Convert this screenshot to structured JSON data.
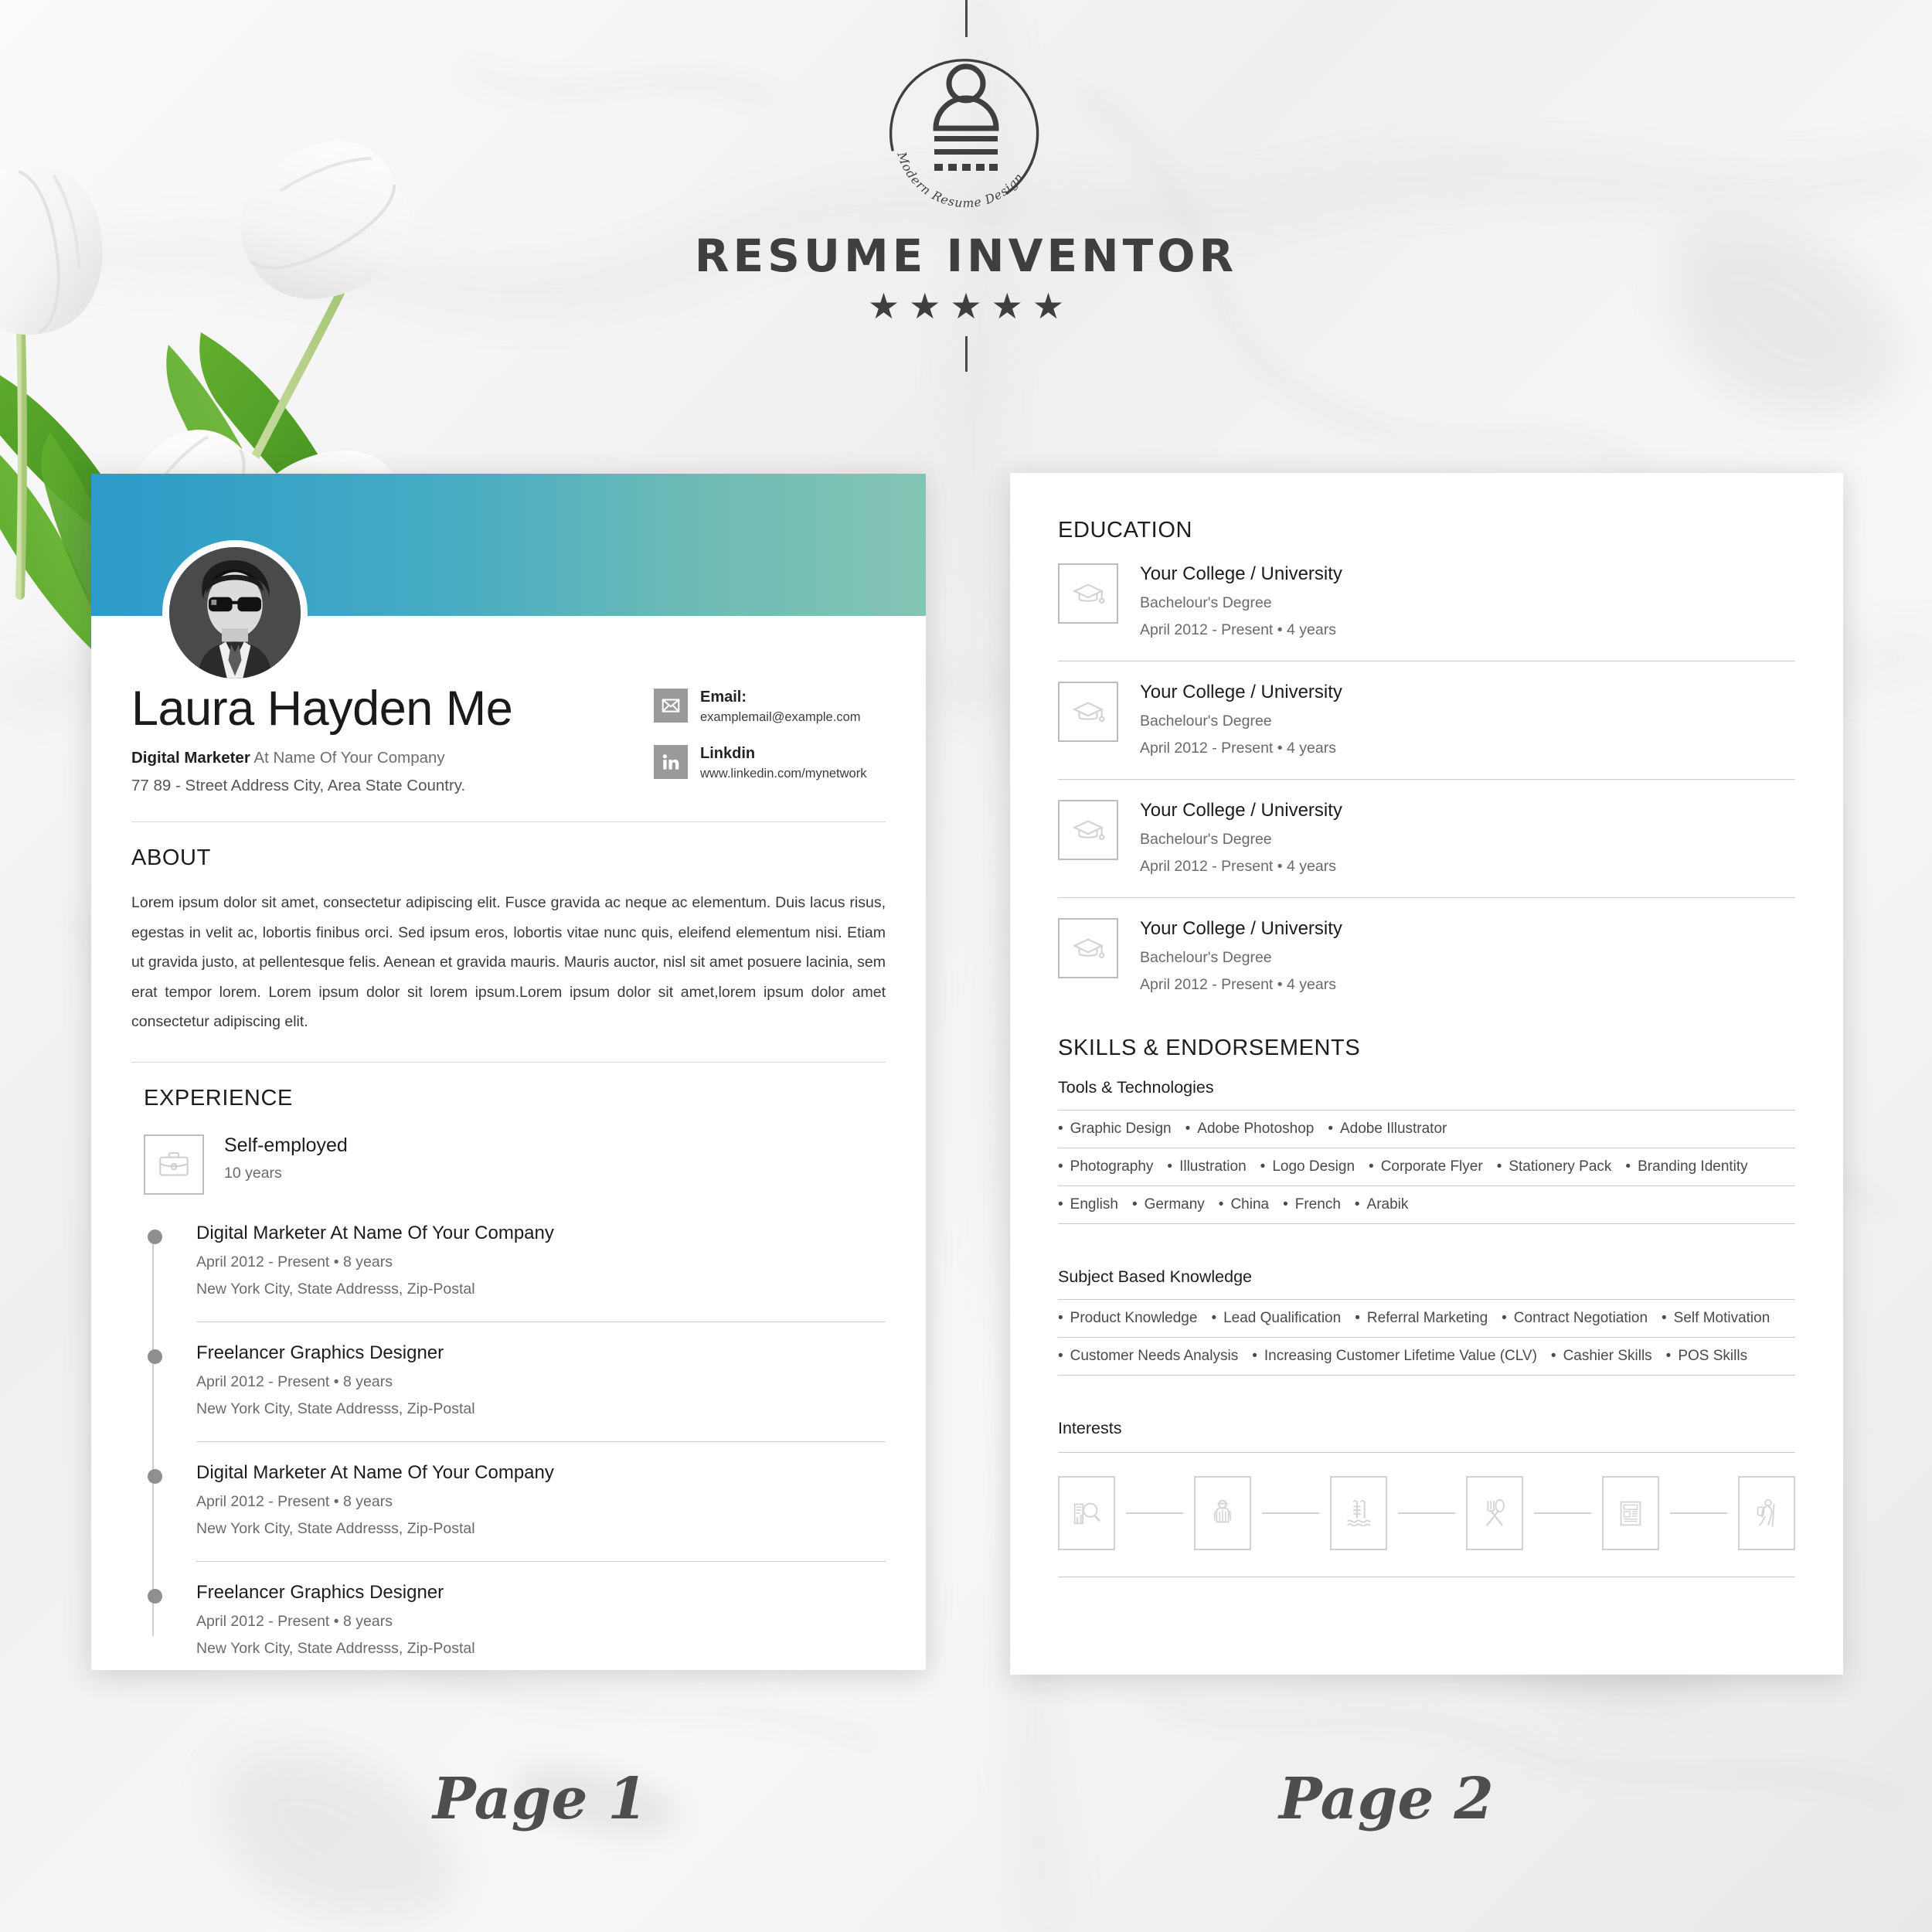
{
  "branding": {
    "title": "RESUME INVENTOR",
    "mark_tagline": "Modern Resume Design",
    "stars": "★ ★ ★ ★ ★",
    "star_count": 5
  },
  "page1": {
    "label": "Page 1",
    "avatar_alt": "profile-photo",
    "identity": {
      "full_name": "Laura Hayden Me",
      "role_bold": "Digital Marketer",
      "role_rest": "At Name Of Your Company",
      "address": "77 89 - Street Address City, Area State Country."
    },
    "contacts": [
      {
        "icon": "envelope-icon",
        "label": "Email:",
        "value": "examplemail@example.com"
      },
      {
        "icon": "linkedin-icon",
        "label": "Linkdin",
        "value": "www.linkedin.com/mynetwork"
      }
    ],
    "about": {
      "title": "ABOUT",
      "text": "Lorem ipsum dolor sit amet, consectetur adipiscing elit. Fusce gravida ac neque ac elementum. Duis lacus risus, egestas in velit ac, lobortis finibus orci. Sed ipsum eros, lobortis vitae nunc quis, eleifend elementum nisi. Etiam ut gravida justo, at pellentesque felis. Aenean et gravida mauris. Mauris auctor, nisl sit amet posuere lacinia, sem erat tempor lorem. Lorem ipsum dolor sit lorem ipsum.Lorem ipsum dolor sit amet,lorem ipsum dolor amet consectetur adipiscing elit."
    },
    "experience": {
      "title": "EXPERIENCE",
      "employer": {
        "icon": "briefcase-icon",
        "name": "Self-employed",
        "duration": "10 years"
      },
      "items": [
        {
          "title": "Digital Marketer At Name Of Your Company",
          "meta": "April 2012 - Present  •  8 years",
          "location": "New York City, State Addresss, Zip-Postal"
        },
        {
          "title": "Freelancer Graphics Designer",
          "meta": "April 2012 - Present  •  8 years",
          "location": "New York City, State Addresss, Zip-Postal"
        },
        {
          "title": "Digital Marketer At Name Of Your Company",
          "meta": "April 2012 - Present  •  8 years",
          "location": "New York City, State Addresss, Zip-Postal"
        },
        {
          "title": "Freelancer Graphics Designer",
          "meta": "April 2012 - Present  •  8 years",
          "location": "New York City, State Addresss, Zip-Postal"
        }
      ]
    }
  },
  "page2": {
    "label": "Page 2",
    "education": {
      "title": "EDUCATION",
      "items": [
        {
          "icon": "graduation-cap-icon",
          "school": "Your College / University",
          "degree": "Bachelour's Degree",
          "meta": "April 2012 - Present  •  4 years"
        },
        {
          "icon": "graduation-cap-icon",
          "school": "Your College / University",
          "degree": "Bachelour's Degree",
          "meta": "April 2012 - Present  •  4 years"
        },
        {
          "icon": "graduation-cap-icon",
          "school": "Your College / University",
          "degree": "Bachelour's Degree",
          "meta": "April 2012 - Present  •  4 years"
        },
        {
          "icon": "graduation-cap-icon",
          "school": "Your College / University",
          "degree": "Bachelour's Degree",
          "meta": "April 2012 - Present  •  4 years"
        }
      ]
    },
    "skills": {
      "title": "SKILLS & ENDORSEMENTS",
      "groups": [
        {
          "heading": "Tools & Technologies",
          "rows": [
            [
              "Graphic Design",
              "Adobe Photoshop",
              "Adobe Illustrator"
            ],
            [
              "Photography",
              "Illustration",
              "Logo Design",
              "Corporate Flyer",
              "Stationery Pack",
              "Branding Identity"
            ],
            [
              "English",
              "Germany",
              "China",
              "French",
              "Arabik"
            ]
          ]
        },
        {
          "heading": "Subject Based Knowledge",
          "rows": [
            [
              "Product Knowledge",
              "Lead Qualification",
              "Referral Marketing",
              "Contract Negotiation",
              "Self Motivation"
            ],
            [
              "Customer Needs Analysis",
              "Increasing Customer Lifetime Value (CLV)",
              "Cashier Skills",
              "POS Skills"
            ]
          ]
        }
      ]
    },
    "interests": {
      "title": "Interests",
      "icons": [
        "research-analytics-icon",
        "hiker-icon",
        "swimming-pool-icon",
        "dining-icon",
        "newspaper-icon",
        "trekking-icon"
      ]
    }
  },
  "colors": {
    "band_start": "#2b9bc9",
    "band_end": "#84c4b4",
    "icon_badge": "#9a9a9a",
    "rule": "#cdcdcd",
    "heading": "#1e1e1e",
    "body_text": "#3a3a3a",
    "muted_text": "#6a6a6a"
  }
}
